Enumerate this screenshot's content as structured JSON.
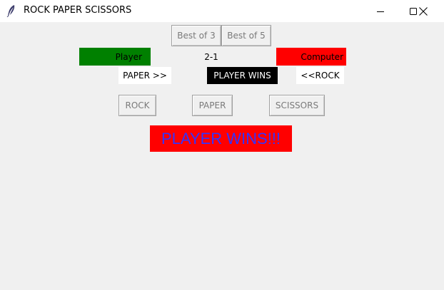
{
  "window": {
    "title": "ROCK PAPER SCISSORS"
  },
  "mode_buttons": {
    "best_of_3": "Best of 3",
    "best_of_5": "Best of 5"
  },
  "scoreboard": {
    "player_label": "Player",
    "score": "2-1",
    "computer_label": "Computer",
    "player_color": "#008000",
    "computer_color": "#ff0000"
  },
  "round": {
    "player_choice": "PAPER >>",
    "result": "PLAYER WINS",
    "computer_choice": "<<ROCK"
  },
  "choices": {
    "rock": "ROCK",
    "paper": "PAPER",
    "scissors": "SCISSORS"
  },
  "final_result": {
    "text": "PLAYER WINS!!!",
    "background": "#ff0000",
    "text_color": "#3333ff"
  }
}
